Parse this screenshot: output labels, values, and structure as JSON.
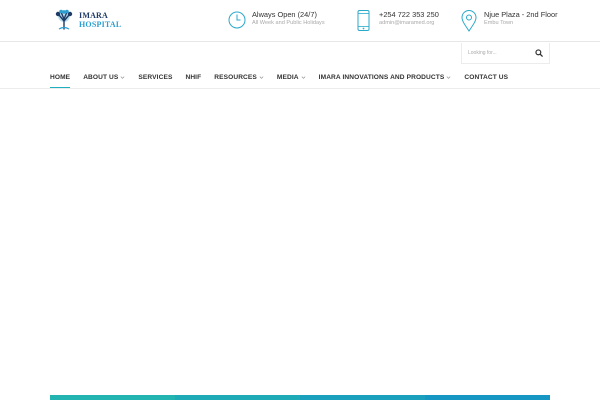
{
  "brand": {
    "line1": "IMARA",
    "line2": "HOSPITAL",
    "logo_icon": "tree-logo-icon"
  },
  "info": [
    {
      "icon": "clock-icon",
      "title": "Always Open (24/7)",
      "subtitle": "All Week and Public Holidays"
    },
    {
      "icon": "mobile-phone-icon",
      "title": "+254 722 353 250",
      "subtitle": "admin@imaramed.org"
    },
    {
      "icon": "map-pin-icon",
      "title": "Njue Plaza - 2nd Floor",
      "subtitle": "Embu Town"
    }
  ],
  "search": {
    "placeholder": "Looking for...",
    "button_icon": "search-icon"
  },
  "nav": {
    "items": [
      {
        "label": "HOME",
        "active": true,
        "dropdown": false
      },
      {
        "label": "ABOUT US",
        "active": false,
        "dropdown": true
      },
      {
        "label": "SERVICES",
        "active": false,
        "dropdown": false
      },
      {
        "label": "NHIF",
        "active": false,
        "dropdown": false
      },
      {
        "label": "RESOURCES",
        "active": false,
        "dropdown": true
      },
      {
        "label": "MEDIA",
        "active": false,
        "dropdown": true
      },
      {
        "label": "IMARA INNOVATIONS AND PRODUCTS",
        "active": false,
        "dropdown": true
      },
      {
        "label": "CONTACT US",
        "active": false,
        "dropdown": false
      }
    ]
  },
  "colors": {
    "accent": "#1fb0bf",
    "icon": "#2aa9c9",
    "footer_strip": [
      "#23b3b1",
      "#1eaab6",
      "#1aa0bc",
      "#1696c2"
    ]
  }
}
